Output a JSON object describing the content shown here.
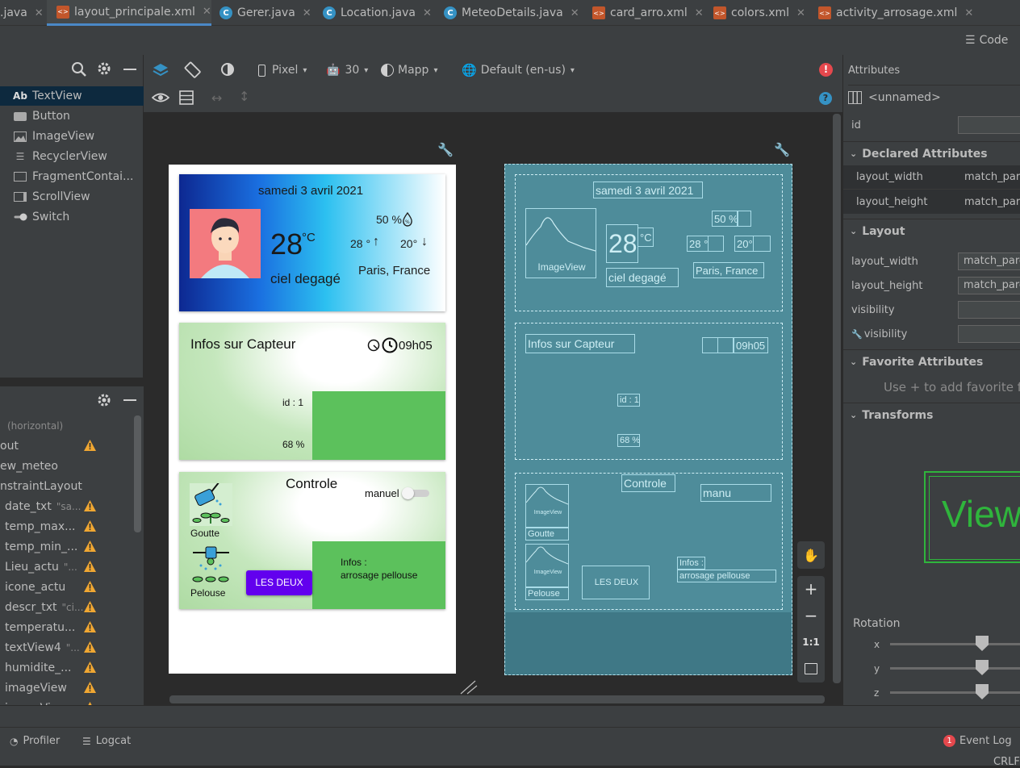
{
  "tabs": [
    {
      "label": ".java",
      "type": "none",
      "active": false
    },
    {
      "label": "layout_principale.xml",
      "type": "xml",
      "active": true
    },
    {
      "label": "Gerer.java",
      "type": "class",
      "active": false
    },
    {
      "label": "Location.java",
      "type": "class",
      "active": false
    },
    {
      "label": "MeteoDetails.java",
      "type": "class",
      "active": false
    },
    {
      "label": "card_arro.xml",
      "type": "xml",
      "active": false
    },
    {
      "label": "colors.xml",
      "type": "xml",
      "active": false
    },
    {
      "label": "activity_arrosage.xml",
      "type": "xml",
      "active": false
    }
  ],
  "view_mode": {
    "code_label": "Code"
  },
  "toolbar": {
    "device": "Pixel",
    "api": "30",
    "theme": "Mapp",
    "locale": "Default (en-us)"
  },
  "palette": {
    "items": [
      {
        "label": "TextView",
        "prefix": "Ab",
        "selected": true
      },
      {
        "label": "Button",
        "selected": false
      },
      {
        "label": "ImageView",
        "selected": false
      },
      {
        "label": "RecyclerView",
        "selected": false
      },
      {
        "label": "FragmentContai...",
        "selected": false
      },
      {
        "label": "ScrollView",
        "selected": false
      },
      {
        "label": "Switch",
        "selected": false
      }
    ]
  },
  "component_tree": {
    "items": [
      {
        "label": "(horizontal)",
        "hint": "",
        "warn": false
      },
      {
        "label": "out",
        "hint": "",
        "warn": true
      },
      {
        "label": "ew_meteo",
        "hint": "",
        "warn": false
      },
      {
        "label": "nstraintLayout",
        "hint": "",
        "warn": false
      },
      {
        "label": "date_txt",
        "hint": "\"sa...",
        "warn": true
      },
      {
        "label": "temp_max...",
        "hint": "",
        "warn": true
      },
      {
        "label": "temp_min_...",
        "hint": "",
        "warn": true
      },
      {
        "label": "Lieu_actu",
        "hint": "\"...",
        "warn": true
      },
      {
        "label": "icone_actu",
        "hint": "",
        "warn": true
      },
      {
        "label": "descr_txt",
        "hint": "\"ci...",
        "warn": true
      },
      {
        "label": "temperatu...",
        "hint": "",
        "warn": true
      },
      {
        "label": "textView4",
        "hint": "\"...",
        "warn": true
      },
      {
        "label": "humidite_...",
        "hint": "",
        "warn": true
      },
      {
        "label": "imageView",
        "hint": "",
        "warn": true
      },
      {
        "label": "imageVie...",
        "hint": "",
        "warn": true
      }
    ]
  },
  "preview": {
    "weather": {
      "date": "samedi 3 avril 2021",
      "temperature": "28",
      "unit": "°C",
      "humidity": "50 %",
      "temp_max": "28 °",
      "temp_min": "20°",
      "location": "Paris, France",
      "description": "ciel degagé"
    },
    "sensor": {
      "title": "Infos sur Capteur",
      "time": "09h05",
      "id": "id : 1",
      "level": "68 %"
    },
    "control": {
      "title": "Controle",
      "switch_label": "manuel",
      "goutte_label": "Goutte",
      "pelouse_label": "Pelouse",
      "button_label": "LES DEUX",
      "info_label": "Infos :",
      "info_value": "arrosage pellouse"
    }
  },
  "blueprint": {
    "date": "samedi 3 avril 2021",
    "imageview": "ImageView",
    "temperature": "28",
    "unit": "°C",
    "humidity": "50 %",
    "temp_max": "28 °",
    "temp_min": "20°",
    "location": "Paris, France",
    "description": "ciel degagé",
    "sensor_title": "Infos sur Capteur",
    "time": "09h05",
    "id": "id : 1",
    "level": "68 %",
    "control_title": "Controle",
    "switch_label": "manu",
    "goutte": "Goutte",
    "pelouse": "Pelouse",
    "button": "LES DEUX",
    "info": "Infos :",
    "info_value": "arrosage pellouse"
  },
  "attributes": {
    "title": "Attributes",
    "component_name": "<unnamed>",
    "id_label": "id",
    "declared_title": "Declared Attributes",
    "declared": [
      {
        "name": "layout_width",
        "value": "match_par"
      },
      {
        "name": "layout_height",
        "value": "match_par"
      }
    ],
    "layout_title": "Layout",
    "layout": [
      {
        "name": "layout_width",
        "value": "match_pare"
      },
      {
        "name": "layout_height",
        "value": "match_pare"
      },
      {
        "name": "visibility",
        "value": ""
      },
      {
        "name": "visibility",
        "value": ""
      }
    ],
    "favorite_title": "Favorite Attributes",
    "favorite_hint": "Use + to add favorite for c",
    "transforms_title": "Transforms",
    "transforms_preview": "View",
    "rotation_label": "Rotation",
    "axes": [
      "x",
      "y",
      "z"
    ]
  },
  "bottom": {
    "profiler": "Profiler",
    "logcat": "Logcat",
    "event_count": "1",
    "event_log": "Event Log",
    "line_sep": "CRLF"
  },
  "colors": {
    "accent": "#4a88c7",
    "warning": "#f0a732",
    "error": "#e5484d",
    "button": "#6200ee",
    "green": "#5cc15c"
  }
}
